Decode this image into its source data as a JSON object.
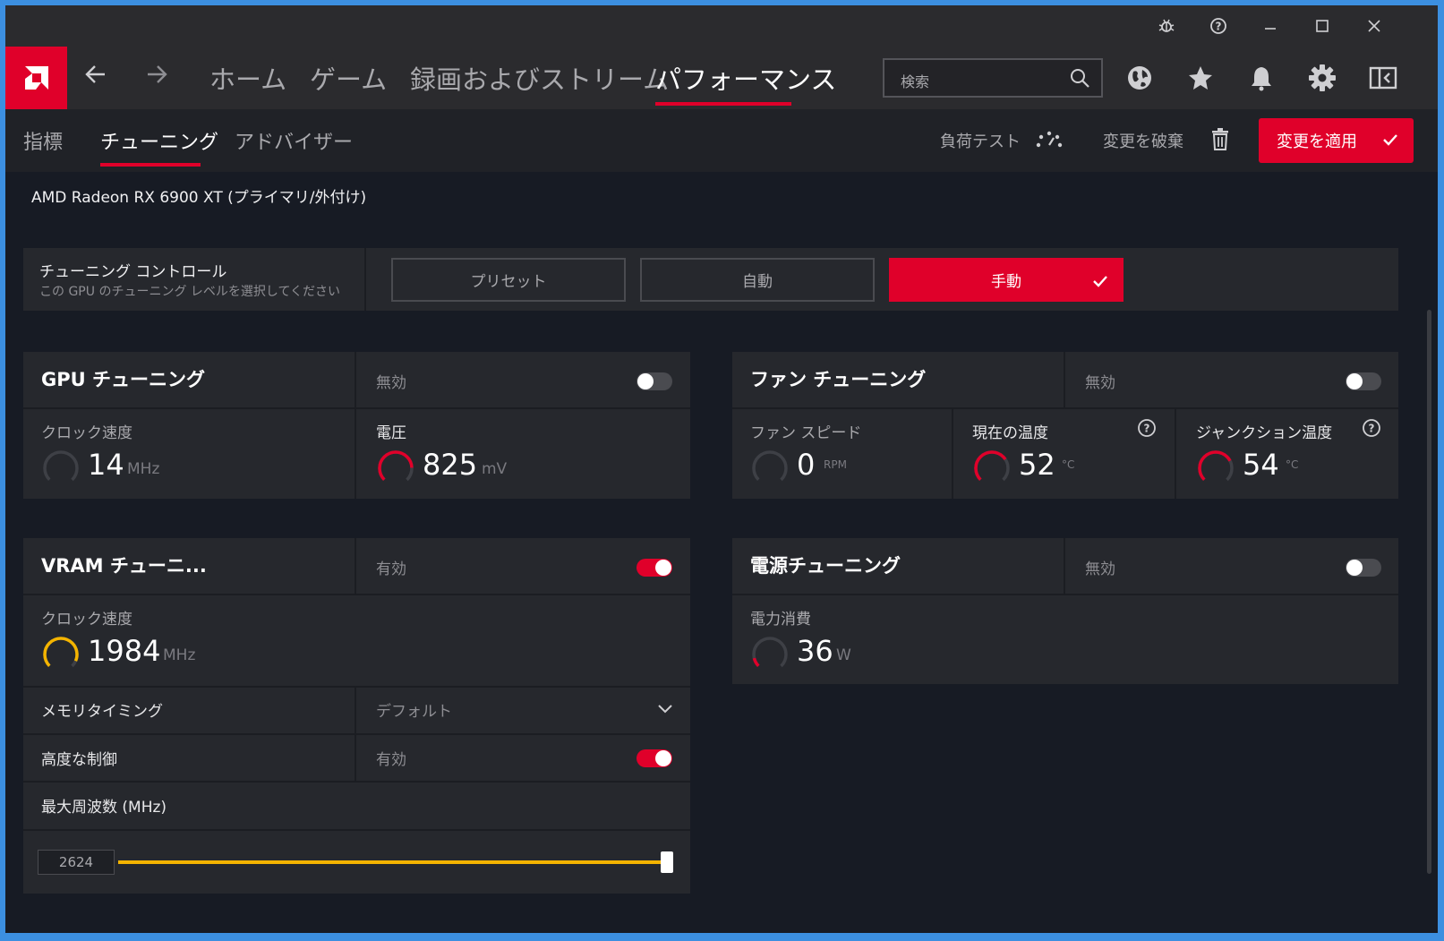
{
  "titlebar": {
    "icons": [
      "bug-icon",
      "help-icon",
      "minimize-icon",
      "maximize-icon",
      "close-icon"
    ]
  },
  "nav": {
    "tabs": [
      {
        "label": "ホーム"
      },
      {
        "label": "ゲーム"
      },
      {
        "label": "録画およびストリーム"
      },
      {
        "label": "パフォーマンス"
      }
    ],
    "active_tab": "パフォーマンス",
    "search_placeholder": "検索",
    "icons": [
      "back-arrow-icon",
      "forward-arrow-icon",
      "globe-icon",
      "star-icon",
      "bell-icon",
      "gear-icon",
      "layout-icon"
    ]
  },
  "subnav": {
    "tabs": [
      {
        "label": "指標"
      },
      {
        "label": "チューニング"
      },
      {
        "label": "アドバイザー"
      }
    ],
    "active_tab": "チューニング",
    "stress_test": "負荷テスト",
    "discard": "変更を破棄",
    "apply": "変更を適用"
  },
  "device": "AMD Radeon RX 6900 XT (プライマリ/外付け)",
  "tuning_control": {
    "title": "チューニング コントロール",
    "subtitle": "この GPU のチューニング レベルを選択してください",
    "modes": [
      "プリセット",
      "自動",
      "手動"
    ],
    "selected": "手動"
  },
  "gpu_tuning": {
    "title": "GPU チューニング",
    "state": "無効",
    "enabled": false,
    "clock_label": "クロック速度",
    "clock_value": "14",
    "clock_unit": "MHz",
    "voltage_label": "電圧",
    "voltage_value": "825",
    "voltage_unit": "mV"
  },
  "fan_tuning": {
    "title": "ファン チューニング",
    "state": "無効",
    "enabled": false,
    "fan_label": "ファン スピード",
    "fan_value": "0",
    "fan_unit": "RPM",
    "temp_label": "現在の温度",
    "temp_value": "52",
    "temp_unit": "°C",
    "junction_label": "ジャンクション温度",
    "junction_value": "54",
    "junction_unit": "°C"
  },
  "vram_tuning": {
    "title": "VRAM チューニ...",
    "state": "有効",
    "enabled": true,
    "clock_label": "クロック速度",
    "clock_value": "1984",
    "clock_unit": "MHz",
    "memory_timing_label": "メモリタイミング",
    "memory_timing_value": "デフォルト",
    "advanced_label": "高度な制御",
    "advanced_state": "有効",
    "advanced_enabled": true,
    "max_freq_label": "最大周波数 (MHz)",
    "max_freq_value": "2624",
    "max_freq_fraction": 1.0
  },
  "power_tuning": {
    "title": "電源チューニング",
    "state": "無効",
    "enabled": false,
    "power_label": "電力消費",
    "power_value": "36",
    "power_unit": "W"
  },
  "colors": {
    "accent": "#e0002a",
    "vram_gauge": "#f4b400",
    "background": "#171b24",
    "panel": "#26282d"
  }
}
